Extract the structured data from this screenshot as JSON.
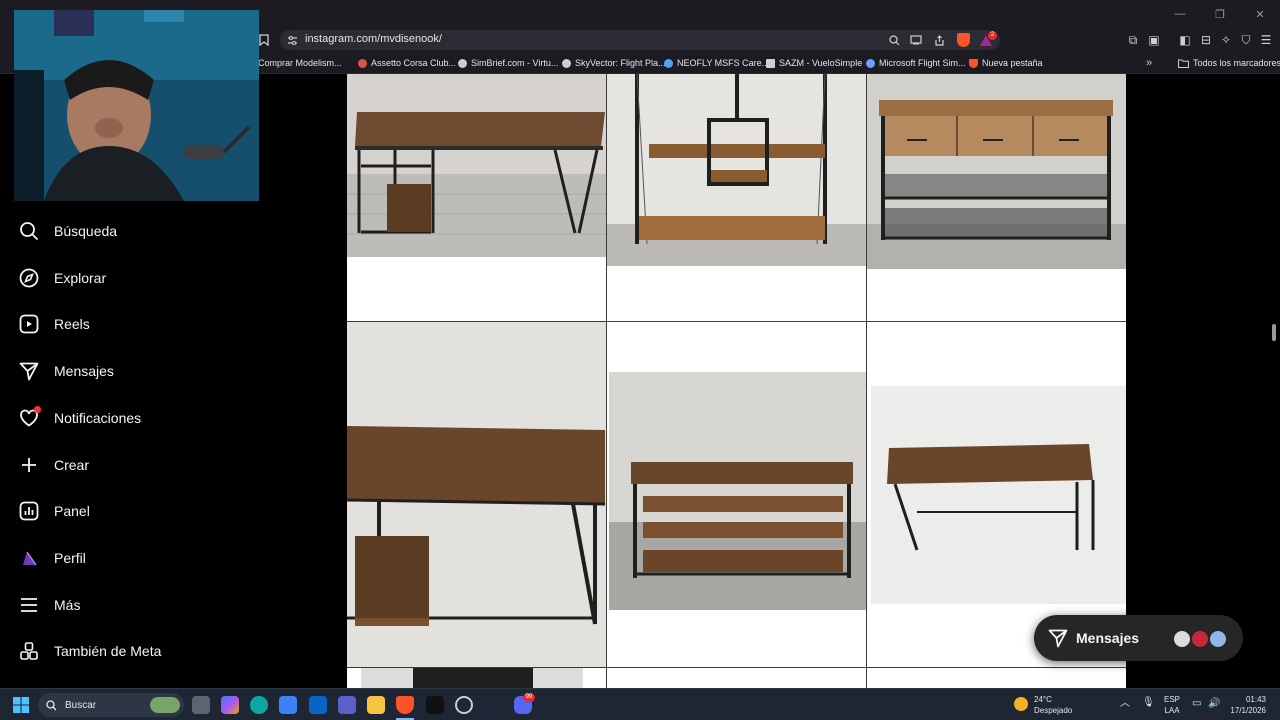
{
  "browser": {
    "url": "instagram.com/mvdisenook/",
    "brave_badge": "2",
    "bookmarks": [
      {
        "label": "Comprar Modelism...",
        "color": "#6aa0ff"
      },
      {
        "label": "Assetto Corsa Club...",
        "color": "#d9534f"
      },
      {
        "label": "SimBrief.com - Virtu...",
        "color": "#cfcfcf"
      },
      {
        "label": "SkyVector: Flight Pla...",
        "color": "#cfcfcf"
      },
      {
        "label": "NEOFLY MSFS Care...",
        "color": "#4ea3ff"
      },
      {
        "label": "SAZM - VueloSimple",
        "color": "#cfcfcf"
      },
      {
        "label": "Microsoft Flight Sim...",
        "color": "#6aa0ff"
      },
      {
        "label": "Nueva pestaña",
        "color": "#fb542b"
      }
    ],
    "all_bookmarks": "Todos los marcadores"
  },
  "sidebar": {
    "items": [
      {
        "label": "Búsqueda",
        "icon": "search-icon"
      },
      {
        "label": "Explorar",
        "icon": "compass-icon"
      },
      {
        "label": "Reels",
        "icon": "reels-icon"
      },
      {
        "label": "Mensajes",
        "icon": "paper-plane-icon"
      },
      {
        "label": "Notificaciones",
        "icon": "heart-icon"
      },
      {
        "label": "Crear",
        "icon": "plus-icon"
      },
      {
        "label": "Panel",
        "icon": "chart-icon"
      },
      {
        "label": "Perfil",
        "icon": "avatar-icon"
      },
      {
        "label": "Más",
        "icon": "menu-icon"
      },
      {
        "label": "También de Meta",
        "icon": "meta-apps-icon"
      }
    ]
  },
  "messages_pill": {
    "label": "Mensajes"
  },
  "taskbar": {
    "search_placeholder": "Buscar",
    "weather_temp": "24°C",
    "weather_desc": "Despejado",
    "lang_1": "ESP",
    "lang_2": "LAA",
    "time": "01:43",
    "date": "17/1/2026",
    "notification_badge": "99"
  }
}
